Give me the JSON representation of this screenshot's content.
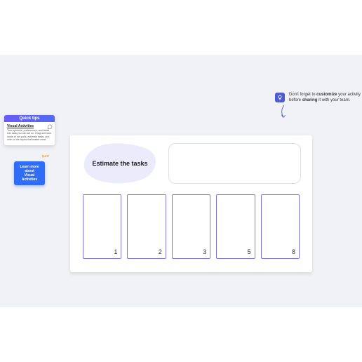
{
  "hint": {
    "prefix": "Don't forget to ",
    "bold1": "customize",
    "mid1": " your activity before ",
    "bold2": "sharing",
    "suffix": " it with your team.",
    "icon": "lightbulb-icon"
  },
  "tips": {
    "header": "Quick tips",
    "title": "Visual Activities",
    "desc": "Turn opinions, preferences, and ideas into data you can act on. Drag and rank cards to run polls, estimate tasks, and vote on the topics that matter most.",
    "icon": "chat-icon"
  },
  "newBadge": "New",
  "learnBtn": {
    "line1": "Learn more about",
    "line2": "Visual Activities"
  },
  "activity": {
    "prompt": "Estimate the tasks",
    "cards": [
      "1",
      "2",
      "3",
      "5",
      "8"
    ]
  },
  "colors": {
    "accent": "#4f5bd5",
    "button": "#2f6df6",
    "cardBorder": "#7b79e8",
    "blob": "#ecebfb"
  }
}
